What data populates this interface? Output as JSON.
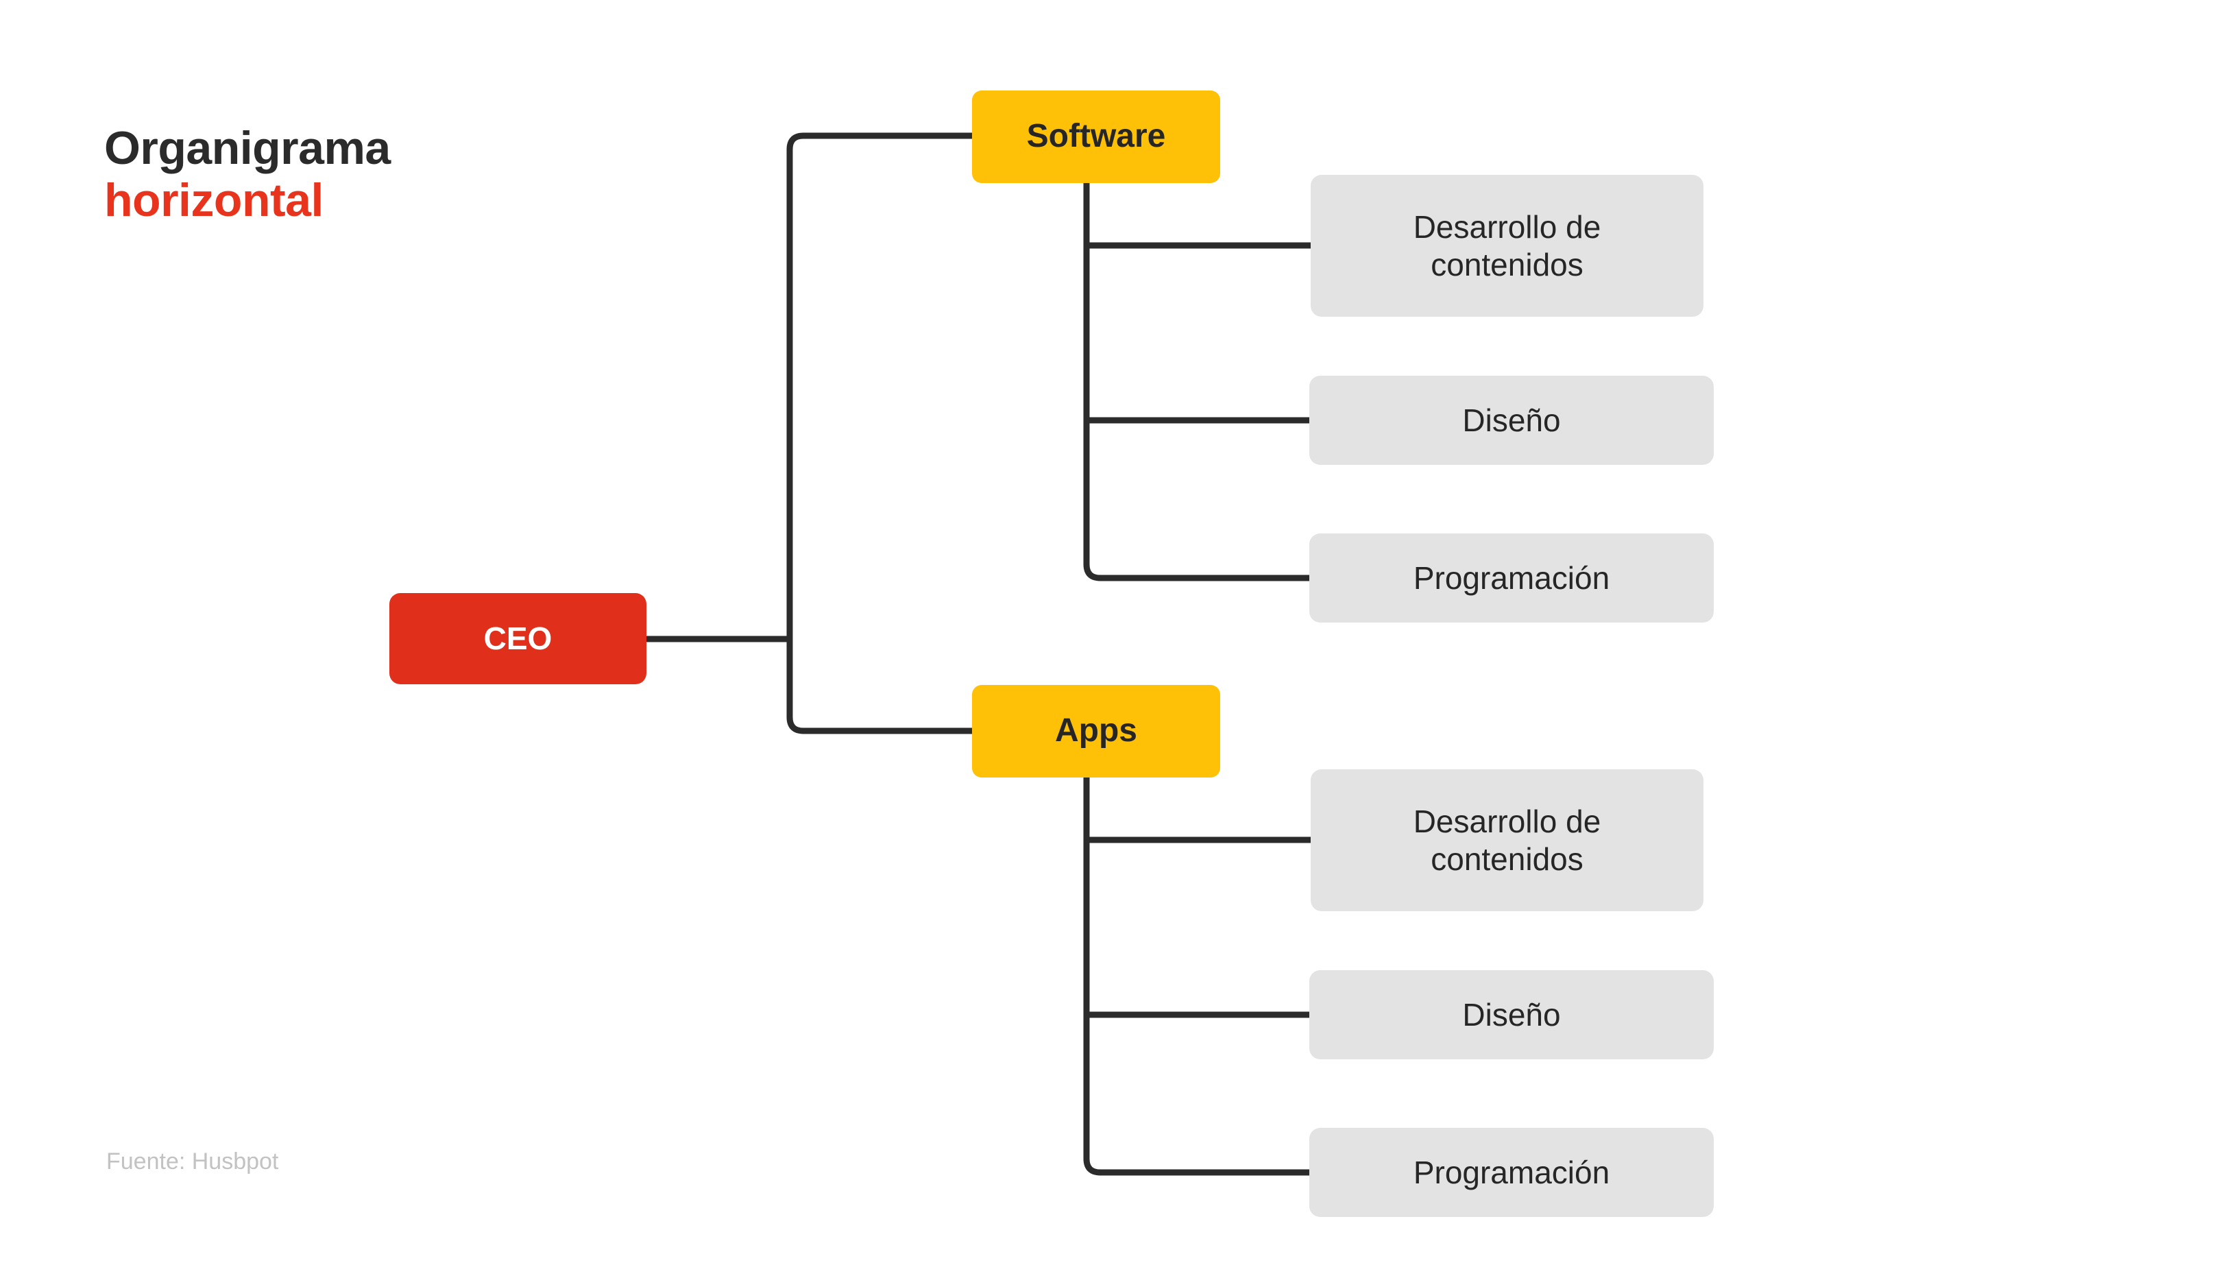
{
  "title": {
    "line1": "Organigrama",
    "line2": "horizontal",
    "color_primary": "#2b2b2b",
    "color_accent": "#E8341C"
  },
  "source": {
    "label": "Fuente: Husbpot",
    "color": "#c2c2c2"
  },
  "colors": {
    "root_box": "#E0301B",
    "branch_box": "#FFC107",
    "leaf_box": "#E3E3E3",
    "connector": "#2b2b2b",
    "background": "#ffffff",
    "root_text": "#ffffff",
    "node_text": "#262626"
  },
  "chart_data": {
    "type": "diagram",
    "subtype": "horizontal-org-chart",
    "orientation": "horizontal",
    "title": "Organigrama horizontal",
    "root": {
      "id": "ceo",
      "label": "CEO",
      "level": 0,
      "style": "root",
      "children": [
        {
          "id": "software",
          "label": "Software",
          "level": 1,
          "style": "branch",
          "children": [
            {
              "id": "software-desarrollo",
              "label": "Desarrollo de contenidos",
              "level": 2,
              "style": "leaf"
            },
            {
              "id": "software-diseno",
              "label": "Diseño",
              "level": 2,
              "style": "leaf"
            },
            {
              "id": "software-programacion",
              "label": "Programación",
              "level": 2,
              "style": "leaf"
            }
          ]
        },
        {
          "id": "apps",
          "label": "Apps",
          "level": 1,
          "style": "branch",
          "children": [
            {
              "id": "apps-desarrollo",
              "label": "Desarrollo de contenidos",
              "level": 2,
              "style": "leaf"
            },
            {
              "id": "apps-diseno",
              "label": "Diseño",
              "level": 2,
              "style": "leaf"
            },
            {
              "id": "apps-programacion",
              "label": "Programación",
              "level": 2,
              "style": "leaf"
            }
          ]
        }
      ]
    }
  },
  "nodes": {
    "ceo": {
      "label": "CEO"
    },
    "software": {
      "label": "Software"
    },
    "apps": {
      "label": "Apps"
    },
    "software_desarrollo": {
      "line1": "Desarrollo de",
      "line2": "contenidos"
    },
    "software_diseno": {
      "label": "Diseño"
    },
    "software_programacion": {
      "label": "Programación"
    },
    "apps_desarrollo": {
      "line1": "Desarrollo de",
      "line2": "contenidos"
    },
    "apps_diseno": {
      "label": "Diseño"
    },
    "apps_programacion": {
      "label": "Programación"
    }
  }
}
